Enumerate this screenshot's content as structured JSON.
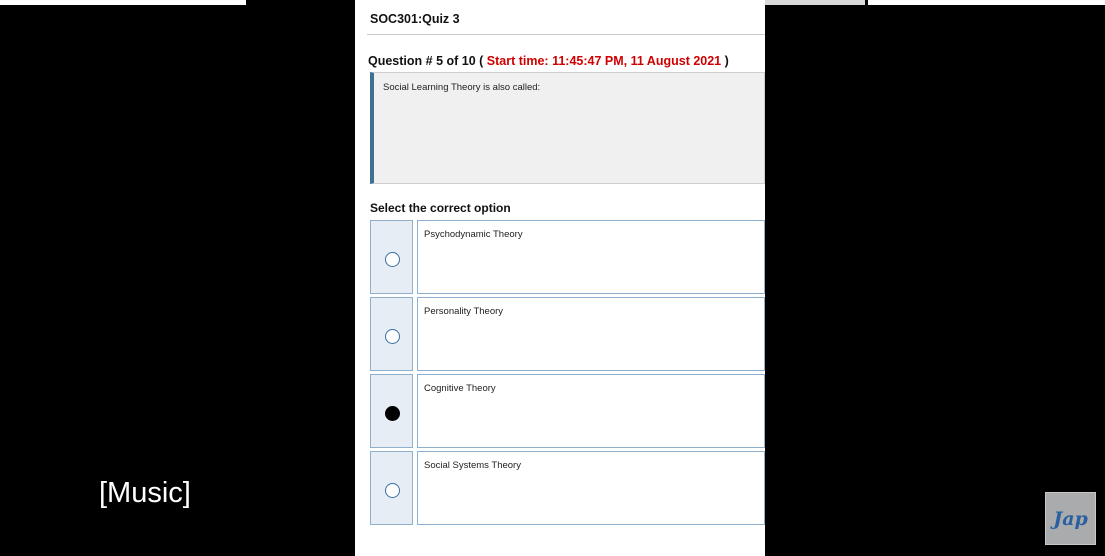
{
  "quiz": {
    "title": "SOC301:Quiz 3",
    "question_prefix": "Question # 5 of 10 ( ",
    "start_time": "Start time: 11:45:47 PM, 11 August 2021",
    "question_suffix": " )",
    "question_text": "Social Learning Theory is also called:",
    "select_label": "Select the correct option",
    "options": [
      {
        "label": "Psychodynamic Theory",
        "selected": false
      },
      {
        "label": "Personality Theory",
        "selected": false
      },
      {
        "label": "Cognitive Theory",
        "selected": true
      },
      {
        "label": "Social Systems Theory",
        "selected": false
      }
    ]
  },
  "video": {
    "caption": "[Music]",
    "logo_text": "Jap"
  },
  "colors": {
    "start_time": "#d00000",
    "accent_border": "#3f6f91",
    "option_border": "#8fb0cd"
  }
}
